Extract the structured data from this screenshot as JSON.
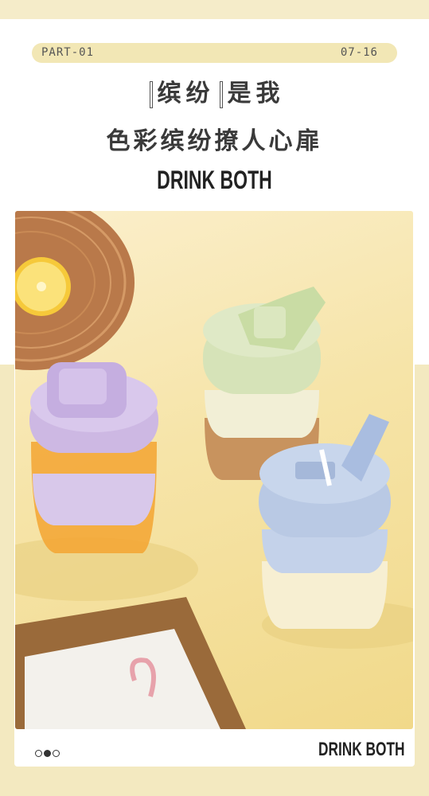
{
  "header": {
    "part_label": "PART-01",
    "date_label": "07-16",
    "headline_word1": "缤纷",
    "headline_word2": "是我",
    "subline": "色彩缤纷撩人心扉",
    "brand": "DRINK BOTH"
  },
  "footer": {
    "brand": "DRINK BOTH",
    "carousel": {
      "total": 3,
      "active": 2
    }
  },
  "colors": {
    "pill": "#f2e7b5",
    "band": "#f3e9c0",
    "cup_purple": "#cdb8e3",
    "cup_green": "#d6e3b8",
    "cup_blue": "#b9c9e4"
  }
}
